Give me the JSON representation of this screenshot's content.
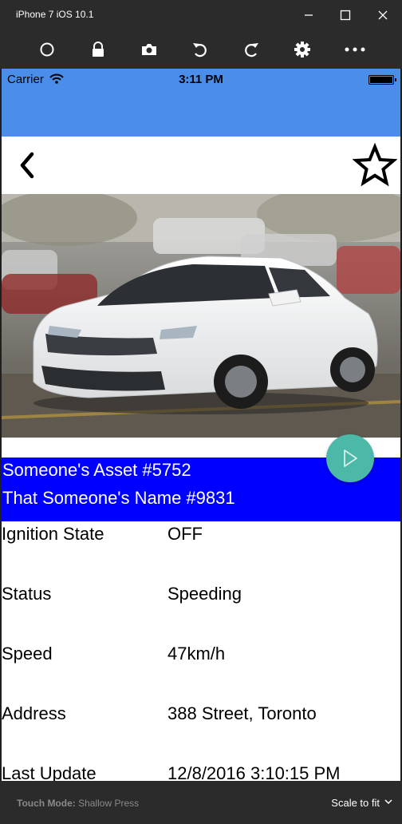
{
  "window": {
    "title": "iPhone 7 iOS 10.1",
    "controls": [
      "minimize-icon",
      "maximize-icon",
      "close-icon"
    ]
  },
  "toolbar": {
    "icons": [
      "home-circle-icon",
      "lock-icon",
      "camera-icon",
      "rotate-left-icon",
      "rotate-right-icon",
      "settings-gear-icon",
      "more-dots-icon"
    ]
  },
  "statusbar": {
    "carrier": "Carrier",
    "time": "3:11 PM"
  },
  "colors": {
    "header_blue": "#4b8eea",
    "asset_band_blue": "#0000ff",
    "fab_teal": "#4bb8a8"
  },
  "asset": {
    "name": "Someone's Asset #5752",
    "owner": "That Someone's Name #9831"
  },
  "details": [
    {
      "label": "Ignition State",
      "value": "OFF"
    },
    {
      "label": "Status",
      "value": "Speeding"
    },
    {
      "label": "Speed",
      "value": "47km/h"
    },
    {
      "label": "Address",
      "value": "388 Street, Toronto"
    },
    {
      "label": "Last Update",
      "value": "12/8/2016 3:10:15 PM"
    }
  ],
  "bottombar": {
    "touch_mode_label": "Touch Mode:",
    "touch_mode_value": "Shallow Press",
    "scale_label": "Scale to fit"
  }
}
